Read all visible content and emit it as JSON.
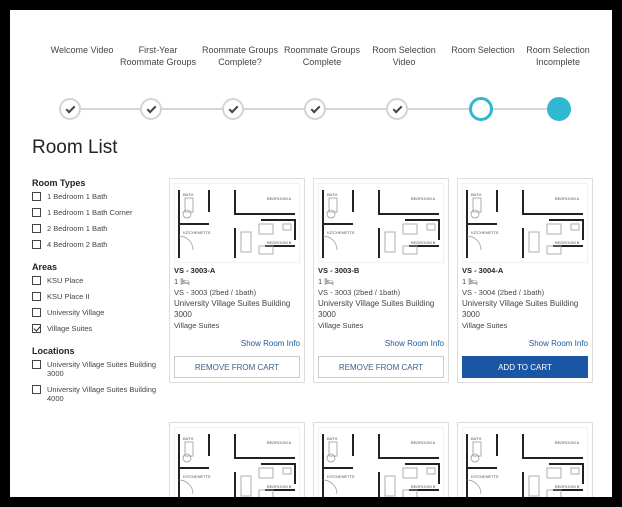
{
  "steps": [
    {
      "label": "Welcome Video",
      "state": "complete"
    },
    {
      "label": "First-Year Roommate Groups",
      "state": "complete"
    },
    {
      "label": "Roommate Groups Complete?",
      "state": "complete"
    },
    {
      "label": "Roommate Groups Complete",
      "state": "complete"
    },
    {
      "label": "Room Selection Video",
      "state": "complete"
    },
    {
      "label": "Room Selection",
      "state": "current"
    },
    {
      "label": "Room Selection Incomplete",
      "state": "upcoming"
    }
  ],
  "page_title": "Room List",
  "filters": {
    "room_types_heading": "Room Types",
    "room_types": [
      {
        "label": "1 Bedroom 1 Bath",
        "checked": false
      },
      {
        "label": "1 Bedroom 1 Bath Corner",
        "checked": false
      },
      {
        "label": "2 Bedroom 1 Bath",
        "checked": false
      },
      {
        "label": "4 Bedroom 2 Bath",
        "checked": false
      }
    ],
    "areas_heading": "Areas",
    "areas": [
      {
        "label": "KSU Place",
        "checked": false
      },
      {
        "label": "KSU Place II",
        "checked": false
      },
      {
        "label": "University Village",
        "checked": false
      },
      {
        "label": "Village Suites",
        "checked": true
      }
    ],
    "locations_heading": "Locations",
    "locations": [
      {
        "label": "University Village Suites Building 3000",
        "checked": false
      },
      {
        "label": "University Village Suites Building 4000",
        "checked": false
      }
    ]
  },
  "plan_labels": {
    "bath": "BATH",
    "bedroom_a": "BEDROOM A",
    "bedroom_b": "BEDROOM B",
    "kitchenette": "KITCHENETTE"
  },
  "rooms": [
    {
      "code": "VS - 3003-A",
      "beds": "1",
      "desc": "VS - 3003 (2bed / 1bath)",
      "building": "University Village Suites Building 3000",
      "area": "Village Suites",
      "show_info": "Show Room Info",
      "action": "REMOVE FROM CART",
      "action_type": "remove"
    },
    {
      "code": "VS - 3003-B",
      "beds": "1",
      "desc": "VS - 3003 (2bed / 1bath)",
      "building": "University Village Suites Building 3000",
      "area": "Village Suites",
      "show_info": "Show Room Info",
      "action": "REMOVE FROM CART",
      "action_type": "remove"
    },
    {
      "code": "VS - 3004-A",
      "beds": "1",
      "desc": "VS - 3004 (2bed / 1bath)",
      "building": "University Village Suites Building 3000",
      "area": "Village Suites",
      "show_info": "Show Room Info",
      "action": "ADD TO CART",
      "action_type": "add"
    }
  ],
  "colors": {
    "accent": "#2fb8cf",
    "primary_button": "#1a56a3",
    "link": "#1f5aa0"
  },
  "icons": {
    "bed": "bed-icon",
    "check": "check-icon"
  }
}
